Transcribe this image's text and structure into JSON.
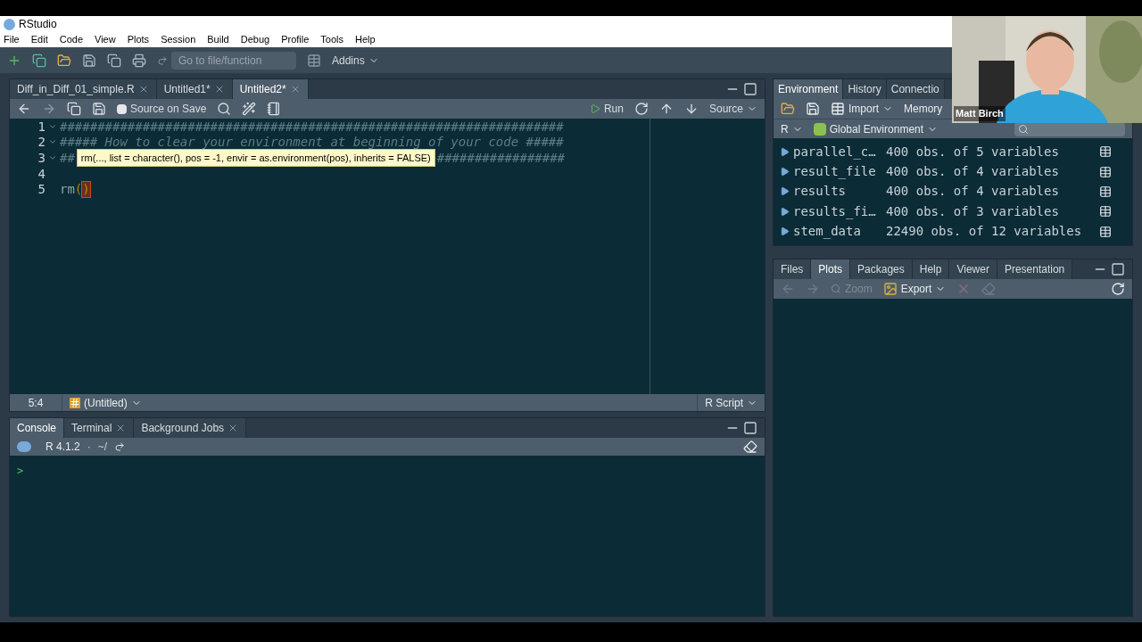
{
  "window": {
    "title": "RStudio"
  },
  "menu": [
    "File",
    "Edit",
    "Code",
    "View",
    "Plots",
    "Session",
    "Build",
    "Debug",
    "Profile",
    "Tools",
    "Help"
  ],
  "toolbar": {
    "goto_placeholder": "Go to file/function",
    "addins": "Addins"
  },
  "source_tabs": [
    {
      "label": "Diff_in_Diff_01_simple.R",
      "selected": false
    },
    {
      "label": "Untitled1*",
      "selected": false
    },
    {
      "label": "Untitled2*",
      "selected": true
    }
  ],
  "source_toolbar": {
    "source_on_save": {
      "label": "Source on Save",
      "checked": false
    },
    "run": "Run",
    "source": "Source"
  },
  "code_lines": [
    {
      "number": "1",
      "foldable": true,
      "segments": [
        {
          "kind": "comment",
          "text": "###################################################################"
        }
      ]
    },
    {
      "number": "2",
      "foldable": true,
      "segments": [
        {
          "kind": "comment",
          "text": "##### How to clear your environment at beginning of your code #####"
        }
      ]
    },
    {
      "number": "3",
      "foldable": true,
      "segments": [
        {
          "kind": "comment",
          "text": "##"
        },
        {
          "kind": "tooltip",
          "text": "rm(..., list = character(), pos = -1, envir = as.environment(pos), inherits = FALSE)"
        },
        {
          "kind": "comment",
          "text": "#################"
        }
      ]
    },
    {
      "number": "4",
      "foldable": false
    },
    {
      "number": "5",
      "foldable": false,
      "segments": [
        {
          "kind": "code",
          "text": "rm"
        },
        {
          "kind": "paren",
          "text": "("
        },
        {
          "kind": "paren_match",
          "text": ")"
        }
      ]
    }
  ],
  "status": {
    "position": "5:4",
    "scope": "(Untitled)",
    "file_type": "R Script"
  },
  "console_tabs": [
    {
      "label": "Console",
      "selected": true,
      "closable": false
    },
    {
      "label": "Terminal",
      "selected": false,
      "closable": true
    },
    {
      "label": "Background Jobs",
      "selected": false,
      "closable": true
    }
  ],
  "console": {
    "version": "R 4.1.2",
    "separator": "·",
    "path": "~/",
    "prompt": ">"
  },
  "env_tabs": [
    {
      "label": "Environment",
      "selected": true
    },
    {
      "label": "History",
      "selected": false
    },
    {
      "label": "Connectio",
      "selected": false
    }
  ],
  "env_toolbar": {
    "import": "Import",
    "memory": "Memory",
    "language": "R",
    "scope": "Global Environment"
  },
  "env_rows": [
    {
      "name": "parallel_c…",
      "value": "400 obs. of 5 variables"
    },
    {
      "name": "result_file",
      "value": "400 obs. of 4 variables"
    },
    {
      "name": "results",
      "value": "400 obs. of 4 variables"
    },
    {
      "name": "results_fi…",
      "value": "400 obs. of 3 variables"
    },
    {
      "name": "stem_data",
      "value": "22490 obs. of 12 variables"
    }
  ],
  "files_tabs": [
    {
      "label": "Files",
      "selected": false
    },
    {
      "label": "Plots",
      "selected": true
    },
    {
      "label": "Packages",
      "selected": false
    },
    {
      "label": "Help",
      "selected": false
    },
    {
      "label": "Viewer",
      "selected": false
    },
    {
      "label": "Presentation",
      "selected": false
    }
  ],
  "plots_toolbar": {
    "zoom": "Zoom",
    "export": "Export"
  },
  "webcam": {
    "caption": "Matt Birch"
  }
}
